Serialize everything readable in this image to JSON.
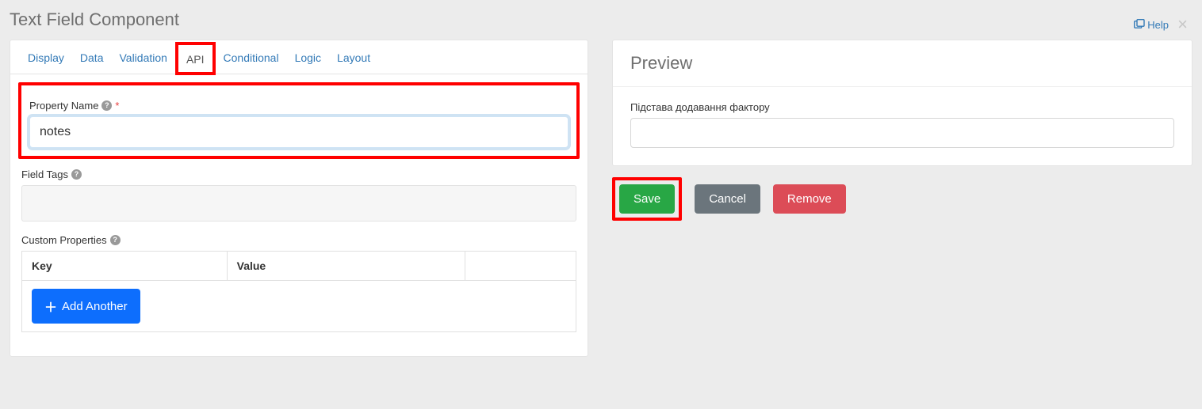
{
  "header": {
    "title": "Text Field Component",
    "help_label": "Help"
  },
  "tabs": [
    {
      "label": "Display"
    },
    {
      "label": "Data"
    },
    {
      "label": "Validation"
    },
    {
      "label": "API"
    },
    {
      "label": "Conditional"
    },
    {
      "label": "Logic"
    },
    {
      "label": "Layout"
    }
  ],
  "active_tab_index": 3,
  "api": {
    "property_name_label": "Property Name",
    "property_name_value": "notes",
    "field_tags_label": "Field Tags",
    "custom_properties_label": "Custom Properties",
    "table_headers": {
      "key": "Key",
      "value": "Value"
    },
    "add_another_label": "Add Another"
  },
  "preview": {
    "title": "Preview",
    "field_label": "Підстава додавання фактору"
  },
  "actions": {
    "save": "Save",
    "cancel": "Cancel",
    "remove": "Remove"
  }
}
